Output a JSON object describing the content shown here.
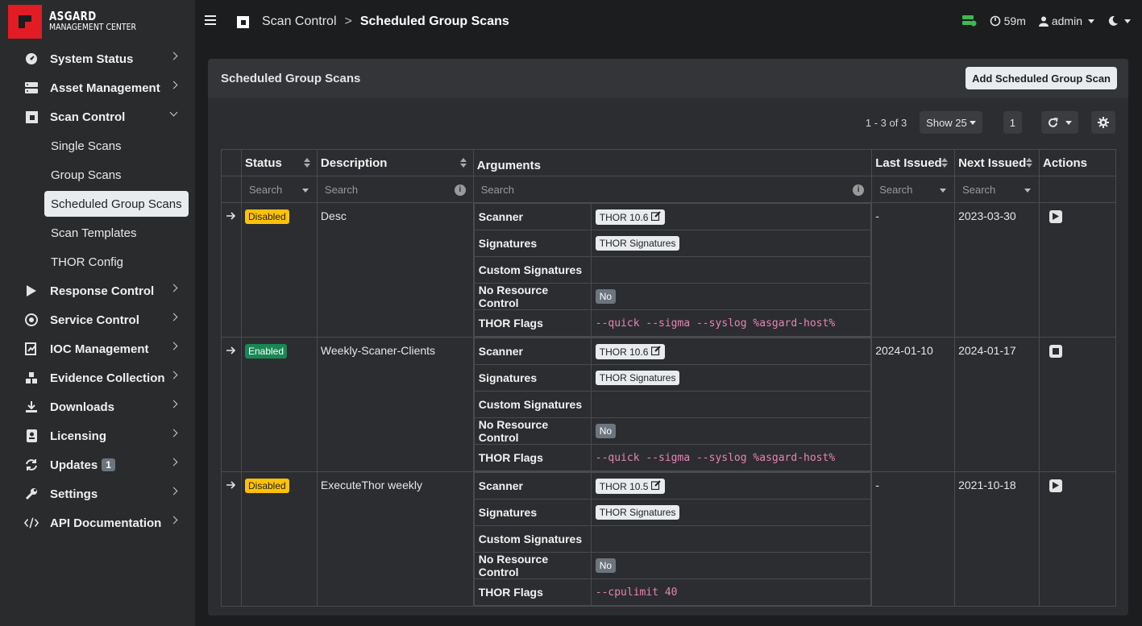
{
  "logo": {
    "line1": "ASGARD",
    "line2": "MANAGEMENT CENTER"
  },
  "sidebar": {
    "items": [
      {
        "label": "System Status"
      },
      {
        "label": "Asset Management"
      },
      {
        "label": "Scan Control"
      },
      {
        "label": "Response Control"
      },
      {
        "label": "Service Control"
      },
      {
        "label": "IOC Management"
      },
      {
        "label": "Evidence Collection"
      },
      {
        "label": "Downloads"
      },
      {
        "label": "Licensing"
      },
      {
        "label": "Updates",
        "badge": "1"
      },
      {
        "label": "Settings"
      },
      {
        "label": "API Documentation"
      }
    ],
    "sub": [
      "Single Scans",
      "Group Scans",
      "Scheduled Group Scans",
      "Scan Templates",
      "THOR Config"
    ]
  },
  "topbar": {
    "crumb_parent": "Scan Control",
    "crumb_sep": ">",
    "crumb_current": "Scheduled Group Scans",
    "timer": "59m",
    "user": "admin"
  },
  "card": {
    "title": "Scheduled Group Scans",
    "add_button": "Add Scheduled Group Scan",
    "count": "1 - 3 of 3",
    "show": "Show 25",
    "page": "1"
  },
  "table": {
    "headers": {
      "status": "Status",
      "description": "Description",
      "arguments": "Arguments",
      "last_issued": "Last Issued",
      "next_issued": "Next Issued",
      "actions": "Actions"
    },
    "search_placeholder": "Search",
    "arg_keys": {
      "scanner": "Scanner",
      "signatures": "Signatures",
      "custom": "Custom Signatures",
      "nrc": "No Resource Control",
      "flags": "THOR Flags"
    },
    "rows": [
      {
        "status": "Disabled",
        "description": "Desc",
        "scanner": "THOR 10.6",
        "signatures": "THOR Signatures",
        "nrc": "No",
        "flags": "--quick --sigma --syslog %asgard-host%",
        "last_issued": "-",
        "next_issued": "2023-03-30"
      },
      {
        "status": "Enabled",
        "description": "Weekly-Scaner-Clients",
        "scanner": "THOR 10.6",
        "signatures": "THOR Signatures",
        "nrc": "No",
        "flags": "--quick --sigma --syslog %asgard-host%",
        "last_issued": "2024-01-10",
        "next_issued": "2024-01-17"
      },
      {
        "status": "Disabled",
        "description": "ExecuteThor weekly",
        "scanner": "THOR 10.5",
        "signatures": "THOR Signatures",
        "nrc": "No",
        "flags": "--cpulimit 40",
        "last_issued": "-",
        "next_issued": "2021-10-18"
      }
    ]
  },
  "colors": {
    "accent_red": "#e11c24",
    "disabled": "#ffc107",
    "enabled": "#198754",
    "flags": "#e685b5"
  }
}
